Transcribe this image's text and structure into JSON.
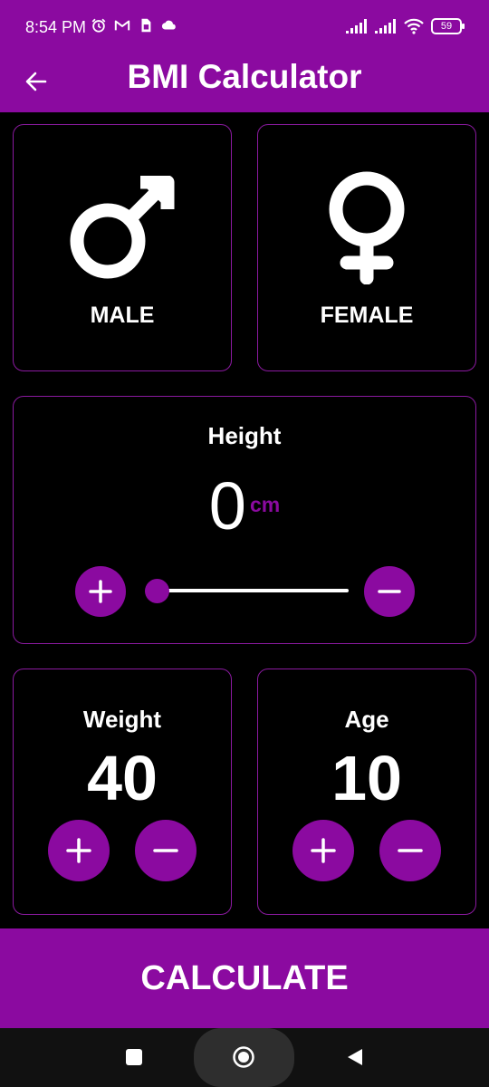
{
  "status_bar": {
    "time": "8:54 PM",
    "battery": "59",
    "left_icons": [
      "alarm-icon",
      "gmail-icon",
      "sim-icon",
      "cloud-icon"
    ],
    "right_icons": [
      "signal-icon",
      "signal-icon",
      "wifi-icon",
      "battery-icon"
    ]
  },
  "app_bar": {
    "title": "BMI Calculator",
    "back_icon": "arrow-left-icon"
  },
  "gender": {
    "male_label": "MALE",
    "female_label": "FEMALE",
    "male_icon": "male-symbol-icon",
    "female_icon": "female-symbol-icon"
  },
  "height": {
    "title": "Height",
    "value": "0",
    "unit": "cm",
    "slider_fraction": 0
  },
  "weight": {
    "title": "Weight",
    "value": "40"
  },
  "age": {
    "title": "Age",
    "value": "10"
  },
  "calculate_label": "CALCULATE",
  "nav_bar": {
    "icons": [
      "recents-icon",
      "home-icon",
      "back-triangle-icon"
    ]
  },
  "colors": {
    "accent": "#8b0aa0",
    "background": "#000000",
    "card_border": "#8b1aa0",
    "text": "#ffffff"
  }
}
